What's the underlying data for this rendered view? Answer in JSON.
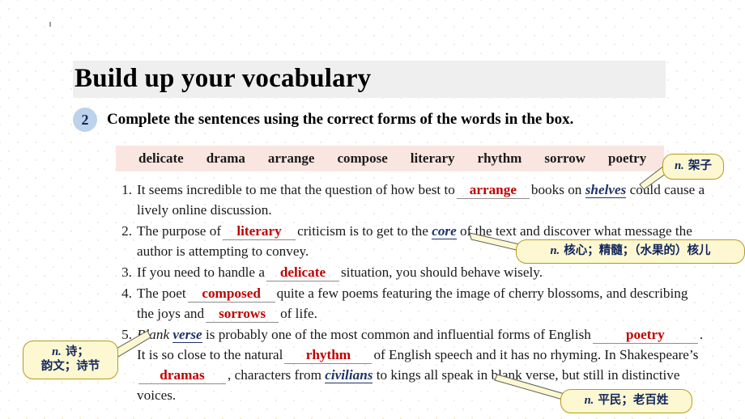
{
  "header": {
    "title": "Build up your vocabulary"
  },
  "task": {
    "number": "2",
    "instruction": "Complete the sentences using the correct forms of the words in the box."
  },
  "word_bank": {
    "words": [
      "delicate",
      "drama",
      "arrange",
      "compose",
      "literary",
      "rhythm",
      "sorrow",
      "poetry"
    ]
  },
  "items": [
    {
      "number": "1.",
      "pre": "It seems incredible to me that the question of how best to",
      "answer": "arrange",
      "mid": "books on",
      "gloss_word": "shelves",
      "post": "could cause a lively online discussion."
    },
    {
      "number": "2.",
      "pre": "The purpose of",
      "answer": "literary",
      "mid": "criticism is to get to the",
      "gloss_word": "core",
      "post": "of the text and discover what message the author is attempting to convey."
    },
    {
      "number": "3.",
      "pre": "If you need to handle a",
      "answer": "delicate",
      "post": "situation, you should behave wisely."
    },
    {
      "number": "4.",
      "pre": "The poet",
      "answer": "composed",
      "mid": "quite a few poems featuring the image of cherry blossoms, and describing the joys and",
      "answer2": "sorrows",
      "post": "of life."
    },
    {
      "number": "5.",
      "lead_italic": "Blank",
      "gloss_word": "verse",
      "pre": "is probably one of the most common and influential forms of English",
      "answer": "poetry",
      "mid": ". It is so close to the natural",
      "answer2": "rhythm",
      "mid2": "of English speech and it has no rhyming. In Shakespeare’s",
      "answer3": "dramas",
      "mid3": ", characters from",
      "gloss_word2": "civilians",
      "post": "to kings all speak in blank verse, but still in distinctive voices."
    }
  ],
  "callouts": {
    "shelves": {
      "pos": "n.",
      "meaning": "架子"
    },
    "core": {
      "pos": "n.",
      "meaning": "核心；精髓；（水果的）核儿"
    },
    "poetry": {
      "pos": "n.",
      "line1": "诗；",
      "line2": "韵文；诗节"
    },
    "civilians": {
      "pos": "n.",
      "meaning": "平民；老百姓"
    }
  },
  "colors": {
    "answer_red": "#c00000",
    "gloss_navy": "#1f3368",
    "header_band": "#efefef",
    "word_bank_pink": "#fae6e1",
    "badge_blue": "#bdd3ec",
    "callout_fill": "#fdf8d2",
    "callout_border": "#b59b1c"
  }
}
